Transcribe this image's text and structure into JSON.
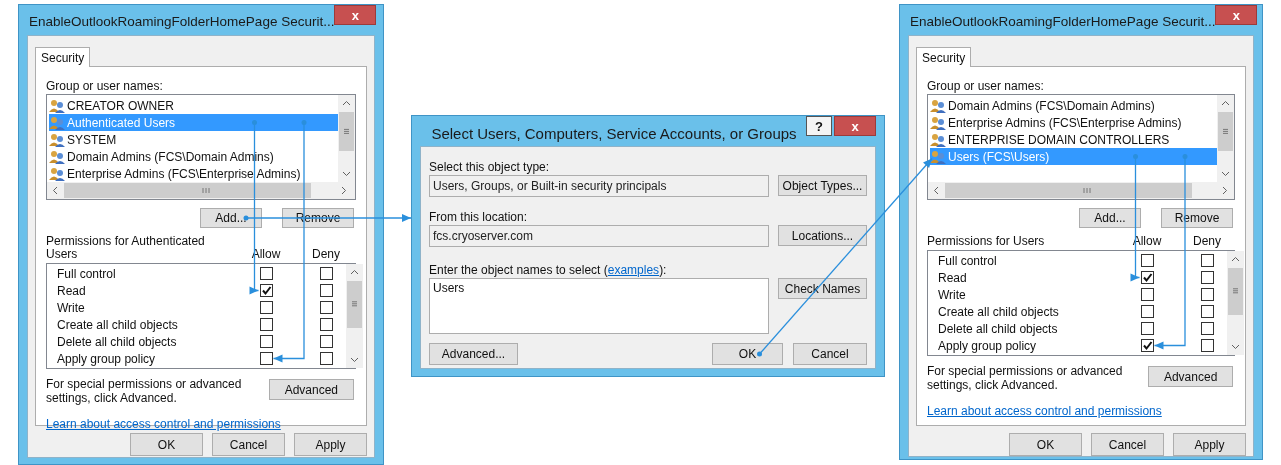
{
  "dialogs": [
    {
      "kind": "security",
      "title": "EnableOutlookRoamingFolderHomePage Securit...",
      "close_label": "x",
      "tabs": [
        {
          "label": "Security",
          "selected": true
        }
      ],
      "group_label": "Group or user names:",
      "users": [
        {
          "name": "CREATOR OWNER",
          "selected": false
        },
        {
          "name": "Authenticated Users",
          "selected": true
        },
        {
          "name": "SYSTEM",
          "selected": false
        },
        {
          "name": "Domain Admins (FCS\\Domain Admins)",
          "selected": false
        },
        {
          "name": "Enterprise Admins (FCS\\Enterprise Admins)",
          "selected": false
        }
      ],
      "add_button": "Add...",
      "remove_button": "Remove",
      "permissions_label": "Permissions for Authenticated Users",
      "allow_header": "Allow",
      "deny_header": "Deny",
      "permissions": [
        {
          "name": "Full control",
          "allow": false,
          "deny": false
        },
        {
          "name": "Read",
          "allow": true,
          "deny": false
        },
        {
          "name": "Write",
          "allow": false,
          "deny": false
        },
        {
          "name": "Create all child objects",
          "allow": false,
          "deny": false
        },
        {
          "name": "Delete all child objects",
          "allow": false,
          "deny": false
        },
        {
          "name": "Apply group policy",
          "allow": false,
          "deny": false
        }
      ],
      "advanced_note": "For special permissions or advanced settings, click Advanced.",
      "advanced_button": "Advanced",
      "link": "Learn about access control and permissions",
      "footer_buttons": [
        "OK",
        "Cancel",
        "Apply"
      ]
    },
    {
      "kind": "select",
      "title": "Select Users, Computers, Service Accounts, or Groups",
      "help_label": "?",
      "close_label": "x",
      "type_label": "Select this object type:",
      "type_value": "Users, Groups, or Built-in security principals",
      "type_button": "Object Types...",
      "location_label": "From this location:",
      "location_value": "fcs.cryoserver.com",
      "location_button": "Locations...",
      "names_label_start": "Enter the object names to select (",
      "names_link": "examples",
      "names_label_end": "):",
      "names_value": "Users",
      "check_button": "Check Names",
      "advanced_button": "Advanced...",
      "ok_button": "OK",
      "cancel_button": "Cancel"
    },
    {
      "kind": "security",
      "title": "EnableOutlookRoamingFolderHomePage Securit...",
      "close_label": "x",
      "tabs": [
        {
          "label": "Security",
          "selected": true
        }
      ],
      "group_label": "Group or user names:",
      "users": [
        {
          "name": "Domain Admins (FCS\\Domain Admins)",
          "selected": false
        },
        {
          "name": "Enterprise Admins (FCS\\Enterprise Admins)",
          "selected": false
        },
        {
          "name": "ENTERPRISE DOMAIN CONTROLLERS",
          "selected": false
        },
        {
          "name": "Users (FCS\\Users)",
          "selected": true
        }
      ],
      "add_button": "Add...",
      "remove_button": "Remove",
      "permissions_label": "Permissions for Users",
      "allow_header": "Allow",
      "deny_header": "Deny",
      "permissions": [
        {
          "name": "Full control",
          "allow": false,
          "deny": false
        },
        {
          "name": "Read",
          "allow": true,
          "deny": false
        },
        {
          "name": "Write",
          "allow": false,
          "deny": false
        },
        {
          "name": "Create all child objects",
          "allow": false,
          "deny": false
        },
        {
          "name": "Delete all child objects",
          "allow": false,
          "deny": false
        },
        {
          "name": "Apply group policy",
          "allow": true,
          "deny": false
        }
      ],
      "advanced_note": "For special permissions or advanced settings, click Advanced.",
      "advanced_button": "Advanced",
      "link": "Learn about access control and permissions",
      "footer_buttons": [
        "OK",
        "Cancel",
        "Apply"
      ]
    }
  ]
}
